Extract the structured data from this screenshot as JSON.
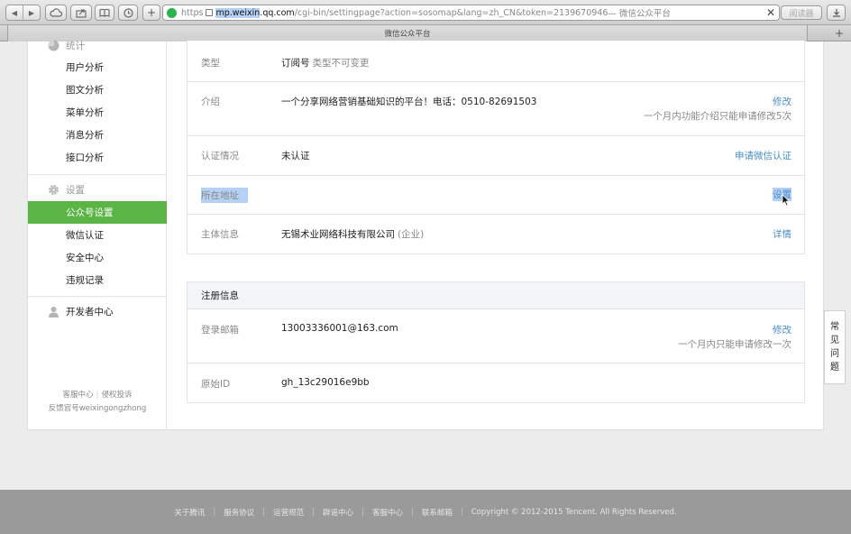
{
  "browser": {
    "url_scheme": "https",
    "url_host_selected": "mp.weixin",
    "url_host_rest": ".qq.com",
    "url_path": "/cgi-bin/settingpage?action=sosomap&lang=zh_CN&token=2139670946",
    "url_title_suffix": " — 微信公众平台",
    "reader_label": "阅读器",
    "tab_title": "微信公众平台",
    "back_icon": "◀",
    "forward_icon": "▶",
    "clear_icon": "✕",
    "new_tab_icon": "+"
  },
  "sidebar": {
    "stats_header": "统计",
    "stats_items": [
      {
        "label": "用户分析"
      },
      {
        "label": "图文分析"
      },
      {
        "label": "菜单分析"
      },
      {
        "label": "消息分析"
      },
      {
        "label": "接口分析"
      }
    ],
    "settings_header": "设置",
    "settings_items": [
      {
        "label": "公众号设置",
        "active": true
      },
      {
        "label": "微信认证"
      },
      {
        "label": "安全中心"
      },
      {
        "label": "违规记录"
      }
    ],
    "developer_header": "开发者中心",
    "footer_links": [
      "客服中心",
      "侵权投诉"
    ],
    "footer_feedback": "反馈官号weixingongzhong"
  },
  "account_info": {
    "rows": [
      {
        "label": "类型",
        "value": "订阅号",
        "hint": "类型不可变更"
      },
      {
        "label": "介绍",
        "value": "一个分享网络营销基础知识的平台！电话：0510-82691503",
        "action": "修改",
        "note": "一个月内功能介绍只能申请修改5次"
      },
      {
        "label": "认证情况",
        "value": "未认证",
        "action": "申请微信认证"
      },
      {
        "label": "所在地址",
        "action": "设置"
      },
      {
        "label": "主体信息",
        "value": "无锡术业网络科技有限公司",
        "hint": "(企业)",
        "action": "详情"
      }
    ]
  },
  "registration": {
    "title": "注册信息",
    "rows": [
      {
        "label": "登录邮箱",
        "value": "13003336001@163.com",
        "action": "修改",
        "note": "一个月内只能申请修改一次"
      },
      {
        "label": "原始ID",
        "value": "gh_13c29016e9bb"
      }
    ]
  },
  "faq_label": [
    "常",
    "见",
    "问",
    "题"
  ],
  "footer_links": [
    "关于腾讯",
    "服务协议",
    "运营规范",
    "辟谣中心",
    "客服中心",
    "联系邮箱"
  ],
  "copyright": "Copyright © 2012-2015 Tencent. All Rights Reserved.",
  "colors": {
    "accent_green": "#5ab545",
    "link_blue": "#4a8ec7",
    "selection": "#b5d1f5",
    "footer_bg": "#9a9a9a"
  }
}
